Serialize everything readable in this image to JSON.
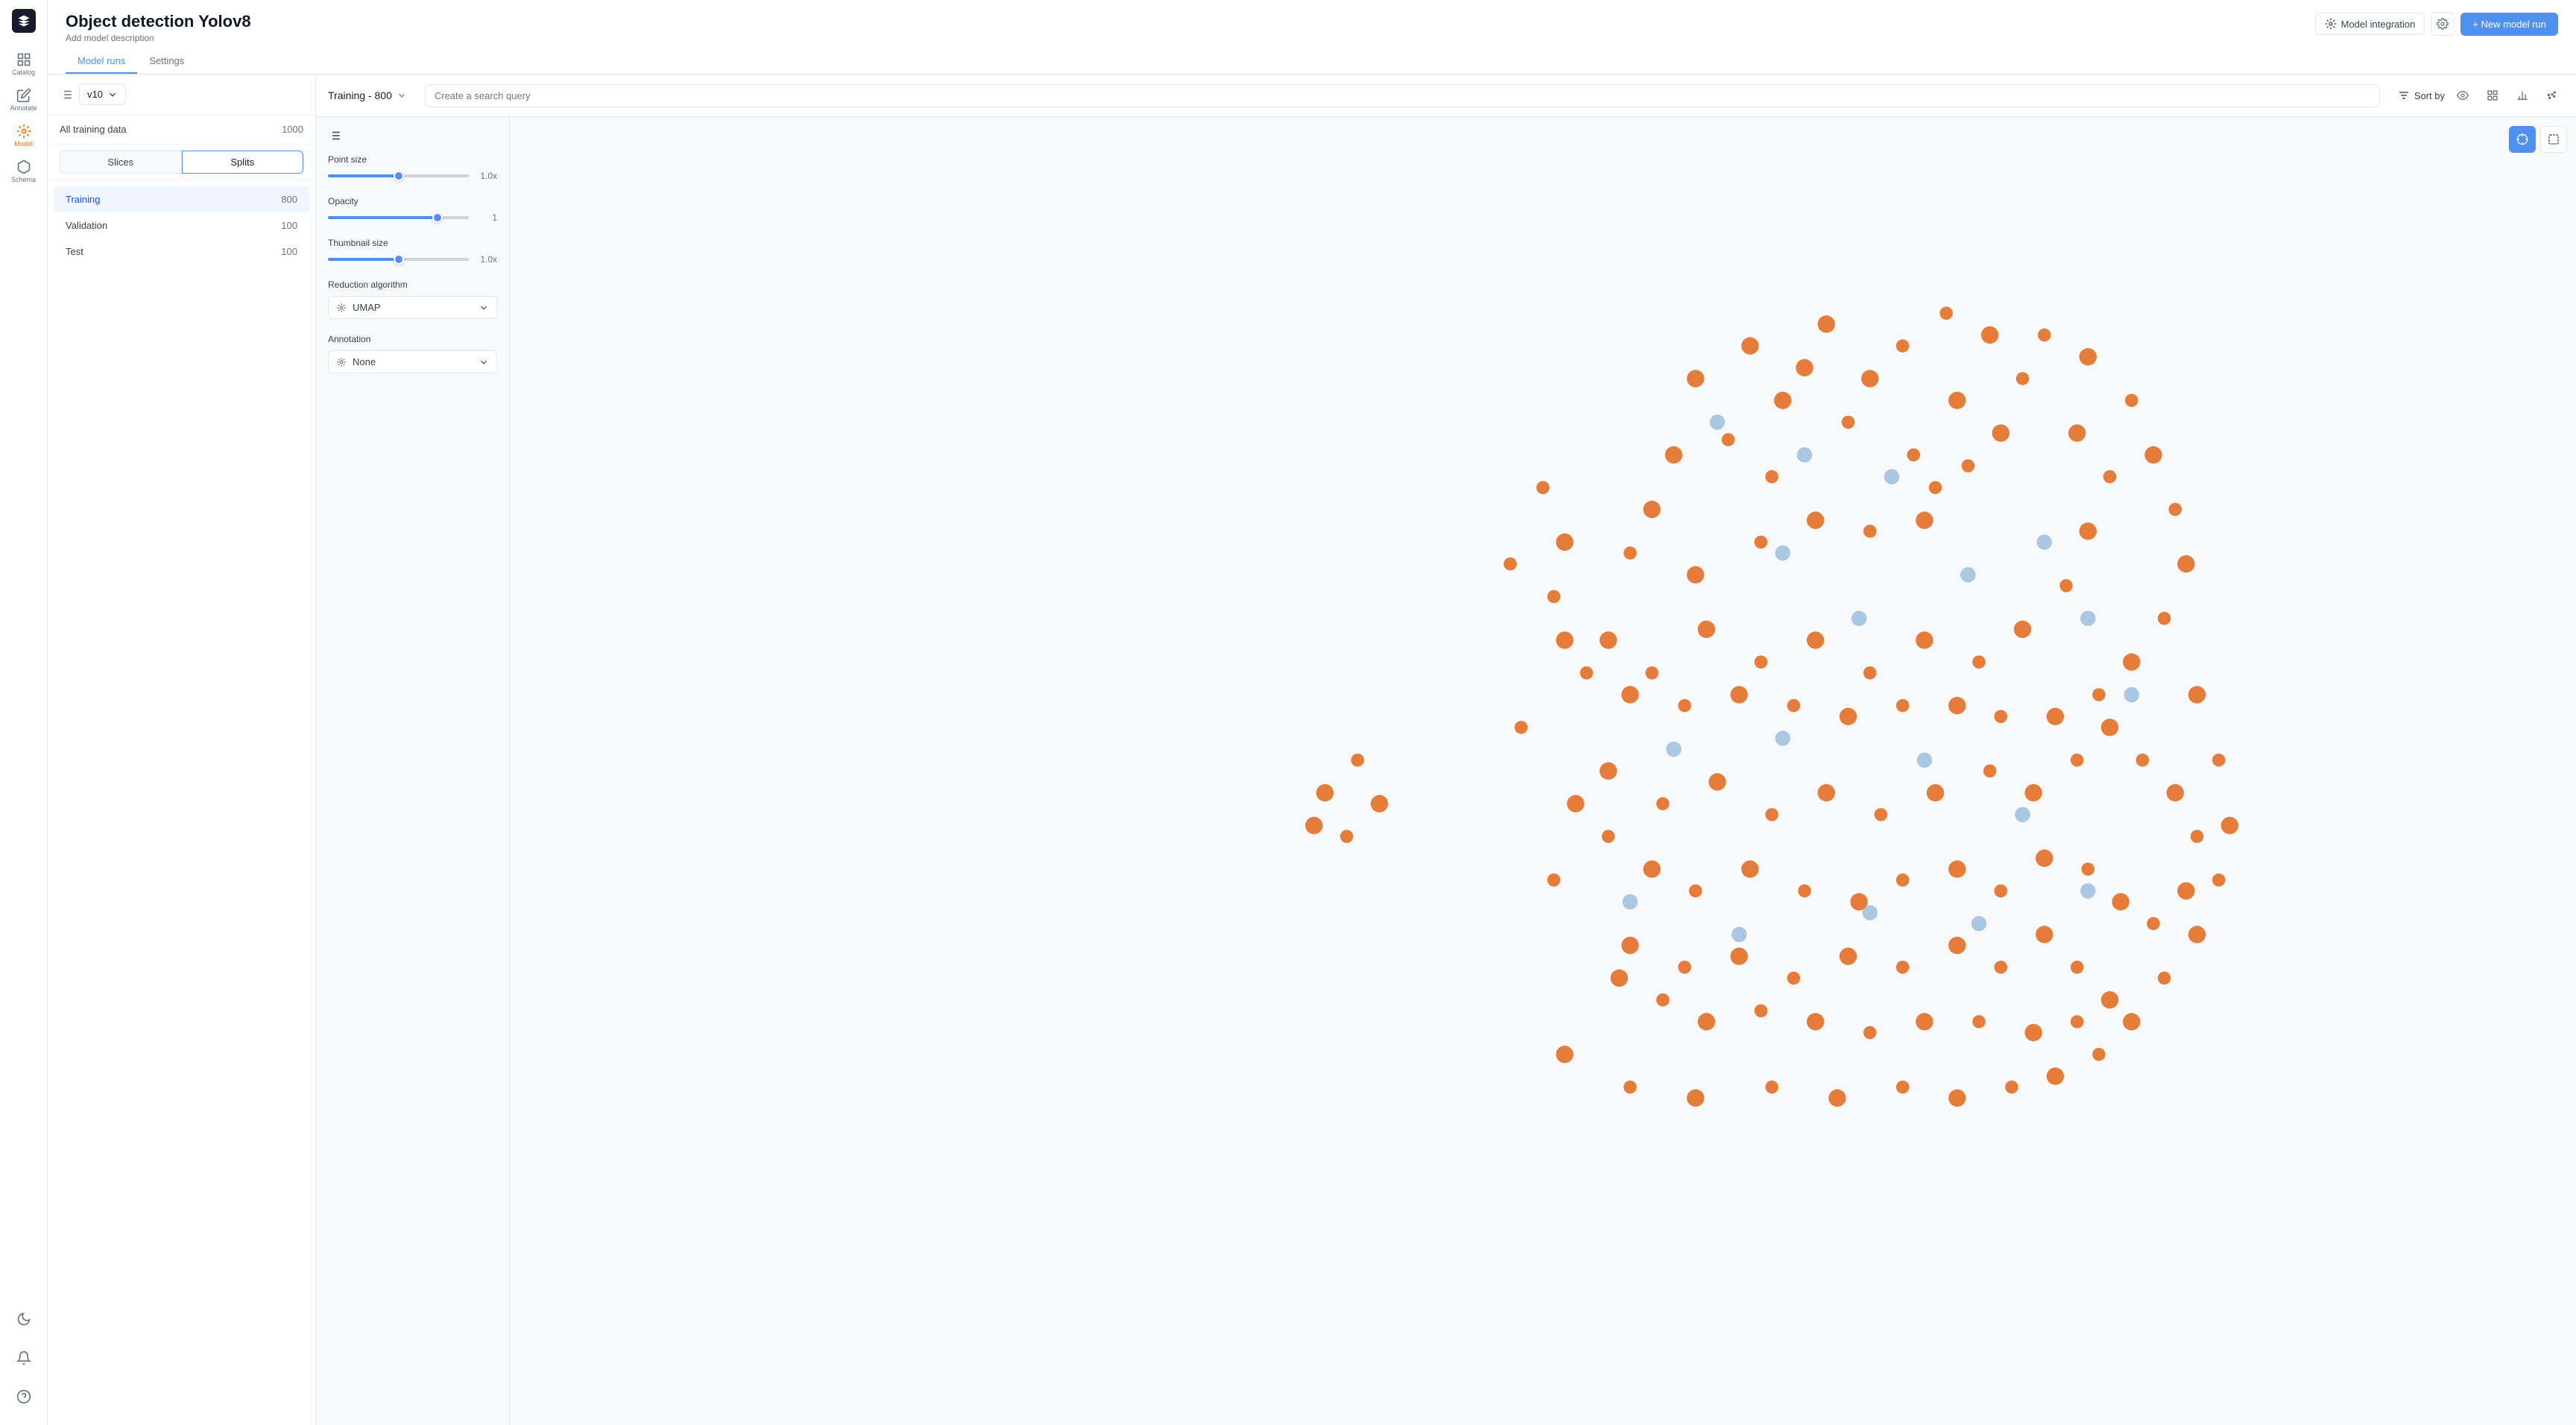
{
  "app": {
    "logo_alt": "App logo"
  },
  "sidebar": {
    "items": [
      {
        "id": "catalog",
        "label": "Catalog",
        "icon": "catalog-icon",
        "active": false
      },
      {
        "id": "annotate",
        "label": "Annotate",
        "icon": "annotate-icon",
        "active": false
      },
      {
        "id": "model",
        "label": "Model",
        "icon": "model-icon",
        "active": true
      },
      {
        "id": "schema",
        "label": "Schema",
        "icon": "schema-icon",
        "active": false
      }
    ],
    "bottom_items": [
      {
        "id": "dark-mode",
        "label": "",
        "icon": "moon-icon"
      },
      {
        "id": "notifications",
        "label": "",
        "icon": "bell-icon"
      },
      {
        "id": "help",
        "label": "",
        "icon": "help-icon"
      }
    ]
  },
  "header": {
    "title": "Object detection Yolov8",
    "subtitle": "Add model description",
    "new_model_btn": "+ New model run",
    "tabs": [
      {
        "id": "model-runs",
        "label": "Model runs",
        "active": true
      },
      {
        "id": "settings",
        "label": "Settings",
        "active": false
      }
    ]
  },
  "left_panel": {
    "version": "v10",
    "all_training_label": "All training data",
    "all_training_count": "1000",
    "tab_slices": "Slices",
    "tab_splits": "Splits",
    "active_tab": "splits",
    "splits": [
      {
        "name": "Training",
        "count": "800",
        "active": true
      },
      {
        "name": "Validation",
        "count": "100",
        "active": false
      },
      {
        "name": "Test",
        "count": "100",
        "active": false
      }
    ]
  },
  "right_area": {
    "training_dropdown": "Training - 800",
    "search_placeholder": "Create a search query",
    "sort_by": "Sort by",
    "model_integration": "Model integration",
    "settings_panel": {
      "point_size_label": "Point size",
      "point_size_value": "1.0x",
      "point_size_pct": 50,
      "opacity_label": "Opacity",
      "opacity_value": "1",
      "opacity_pct": 80,
      "thumbnail_size_label": "Thumbnail size",
      "thumbnail_size_value": "1.0x",
      "thumbnail_size_pct": 50,
      "reduction_label": "Reduction algorithm",
      "reduction_value": "UMAP",
      "annotation_label": "Annotation",
      "annotation_value": "None"
    }
  }
}
